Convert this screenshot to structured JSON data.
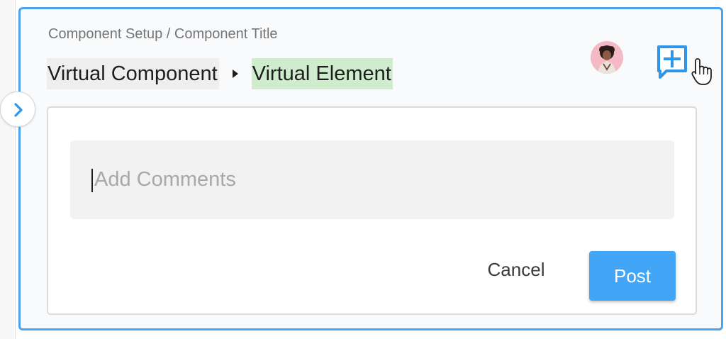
{
  "header": {
    "breadcrumb": "Component Setup / Component Title",
    "path": {
      "component": "Virtual Component",
      "element": "Virtual Element"
    }
  },
  "icons": {
    "toggle": "chevron-right-icon",
    "add_comment": "add-comment-icon",
    "pointer": "hand-pointer-cursor"
  },
  "comment": {
    "placeholder": "Add Comments",
    "value": "",
    "cancel_label": "Cancel",
    "post_label": "Post"
  },
  "colors": {
    "accent": "#42a5f5",
    "panel_border": "#4aa3f0",
    "component_chip": "#eeeeee",
    "element_chip": "#cfeccc"
  }
}
